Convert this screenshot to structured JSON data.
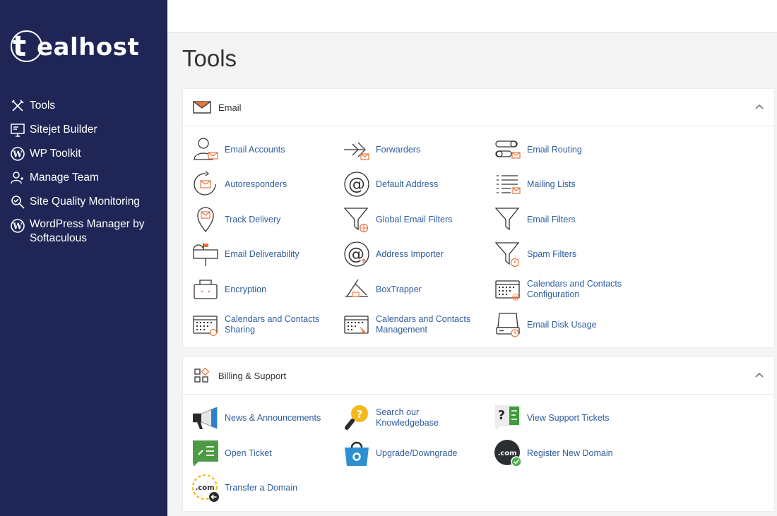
{
  "brand": {
    "logo_letter": "t",
    "logo_rest": "ealhost"
  },
  "sidebar": {
    "items": [
      {
        "label": "Tools",
        "icon": "tools-icon"
      },
      {
        "label": "Sitejet Builder",
        "icon": "monitor-icon"
      },
      {
        "label": "WP Toolkit",
        "icon": "wordpress-icon"
      },
      {
        "label": "Manage Team",
        "icon": "team-icon"
      },
      {
        "label": "Site Quality Monitoring",
        "icon": "magnifier-icon"
      },
      {
        "label": "WordPress Manager by Softaculous",
        "icon": "wordpress-icon"
      }
    ]
  },
  "page": {
    "title": "Tools"
  },
  "email": {
    "title": "Email",
    "tools": [
      "Email Accounts",
      "Forwarders",
      "Email Routing",
      "Autoresponders",
      "Default Address",
      "Mailing Lists",
      "Track Delivery",
      "Global Email Filters",
      "Email Filters",
      "Email Deliverability",
      "Address Importer",
      "Spam Filters",
      "Encryption",
      "BoxTrapper",
      "Calendars and Contacts Configuration",
      "Calendars and Contacts Sharing",
      "Calendars and Contacts Management",
      "Email Disk Usage"
    ]
  },
  "billing": {
    "title": "Billing & Support",
    "tools": [
      "News & Announcements",
      "Search our Knowledgebase",
      "View Support Tickets",
      "Open Ticket",
      "Upgrade/Downgrade",
      "Register New Domain",
      "Transfer a Domain"
    ],
    "dotcom": ".com"
  },
  "colors": {
    "sidebar": "#1f2656",
    "accent": "#e8743b",
    "link": "#2e5d9e"
  }
}
